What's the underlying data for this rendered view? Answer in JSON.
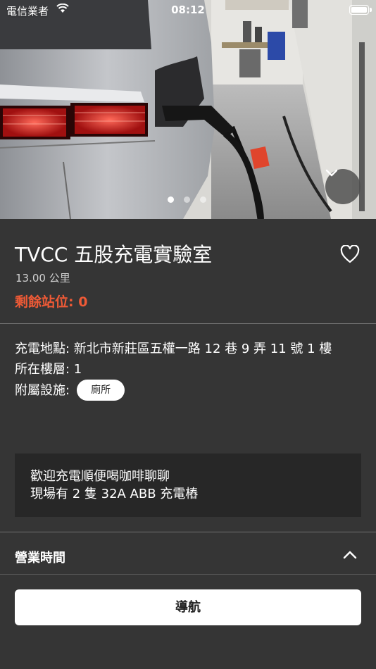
{
  "status_bar": {
    "carrier": "電信業者",
    "time": "08:12"
  },
  "gallery": {
    "page_count": 3,
    "current_page": 1
  },
  "station": {
    "name": "TVCC 五股充電實驗室",
    "distance": "13.00 公里",
    "remaining_label": "剩餘站位: 0"
  },
  "details": {
    "address": "充電地點: 新北市新莊區五權一路 12 巷 9 弄 11 號 1 樓",
    "floor": "所在樓層: 1",
    "facilities_label": "附屬設施:",
    "facility_tags": [
      "廁所"
    ]
  },
  "notice": {
    "lines": [
      "歡迎充電順便喝咖啡聊聊",
      "現場有 2 隻 32A ABB 充電樁"
    ]
  },
  "hours": {
    "title": "營業時間"
  },
  "actions": {
    "navigate_label": "導航"
  },
  "icons": {
    "wifi": "wifi-icon",
    "battery": "battery-icon",
    "collapse": "chevron-down-icon",
    "favorite": "heart-icon",
    "hours_toggle": "chevron-up-icon"
  },
  "colors": {
    "remaining": "#ef5a36",
    "background": "#353535",
    "notice_bg": "#272727",
    "hours_peek": "#3fd0b8"
  }
}
